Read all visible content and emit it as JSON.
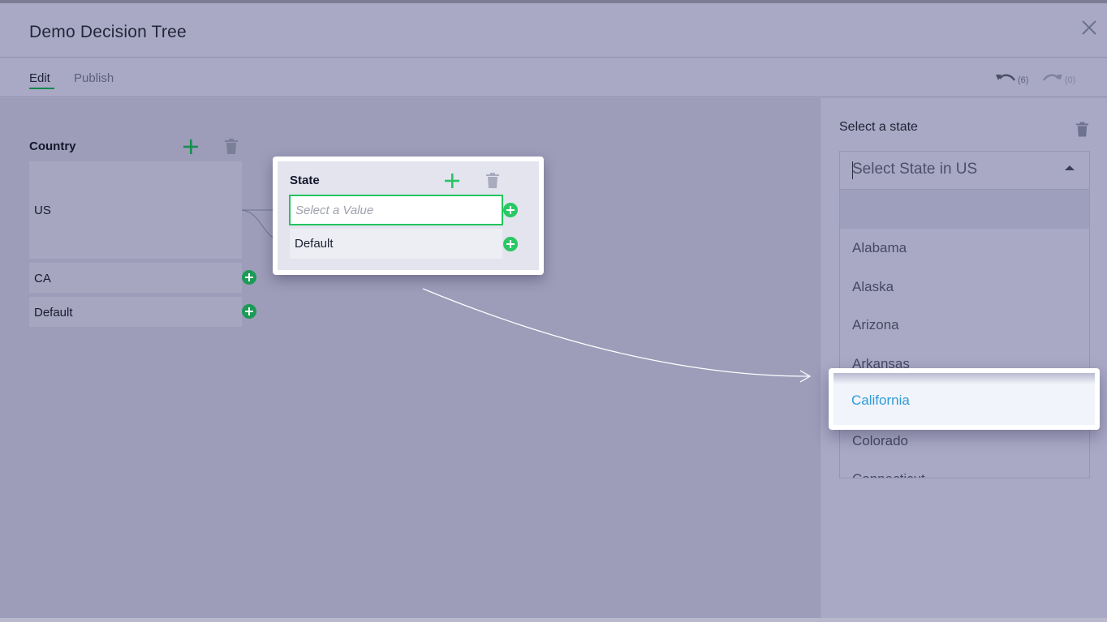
{
  "header": {
    "title": "Demo Decision Tree"
  },
  "tabs": [
    {
      "label": "Edit",
      "active": true
    },
    {
      "label": "Publish",
      "active": false
    }
  ],
  "history": {
    "undo_count": "(6)",
    "redo_count": "(0)"
  },
  "tree": {
    "country": {
      "title": "Country",
      "rows": [
        "US",
        "CA",
        "Default"
      ]
    },
    "state": {
      "title": "State",
      "value_placeholder": "Select a Value",
      "default_label": "Default"
    }
  },
  "panel": {
    "label": "Select a state",
    "select_placeholder": "Select State in US",
    "options": [
      "Alabama",
      "Alaska",
      "Arizona",
      "Arkansas",
      "California",
      "Colorado",
      "Connecticut"
    ],
    "highlighted_option": "California"
  },
  "colors": {
    "accent_green": "#22c55e",
    "add_green": "#1c9a56",
    "highlight_blue": "#2e9bd6"
  }
}
